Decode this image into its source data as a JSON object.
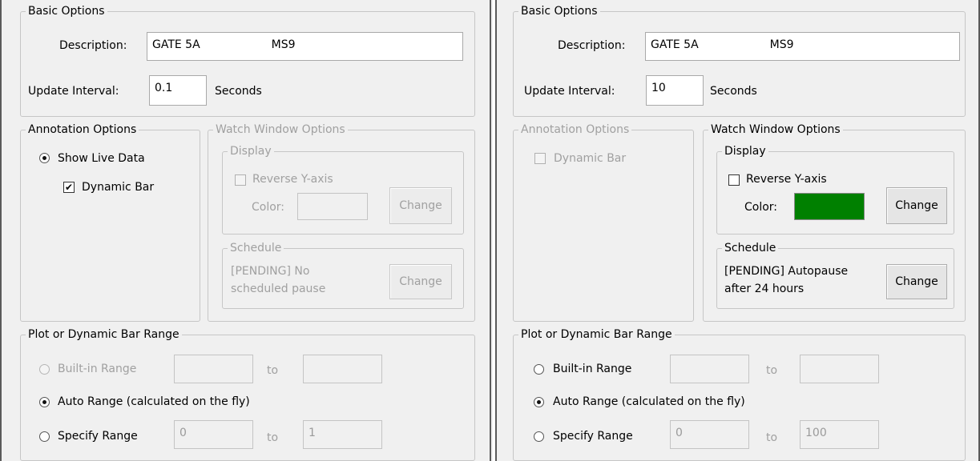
{
  "left": {
    "basic": {
      "legend": "Basic Options",
      "description_label": "Description:",
      "description_value": "GATE 5A                    MS9",
      "interval_label": "Update Interval:",
      "interval_value": "0.1",
      "seconds_label": "Seconds"
    },
    "annotation": {
      "legend": "Annotation Options",
      "show_live_data": "Show Live Data",
      "dynamic_bar": "Dynamic Bar"
    },
    "watch": {
      "legend": "Watch Window Options",
      "display_legend": "Display",
      "reverse_y": "Reverse Y-axis",
      "color_label": "Color:",
      "change_label": "Change",
      "schedule_legend": "Schedule",
      "schedule_text_1": "[PENDING] No",
      "schedule_text_2": "scheduled pause",
      "schedule_change_label": "Change"
    },
    "range": {
      "legend": "Plot or Dynamic Bar Range",
      "builtin": "Built-in Range",
      "auto": "Auto Range (calculated on the fly)",
      "specify": "Specify Range",
      "to1": "to",
      "to2": "to",
      "specify_from": "0",
      "specify_to": "1"
    }
  },
  "right": {
    "basic": {
      "legend": "Basic Options",
      "description_label": "Description:",
      "description_value": "GATE 5A                    MS9",
      "interval_label": "Update Interval:",
      "interval_value": "10",
      "seconds_label": "Seconds"
    },
    "annotation": {
      "legend": "Annotation Options",
      "dynamic_bar": "Dynamic Bar"
    },
    "watch": {
      "legend": "Watch Window Options",
      "display_legend": "Display",
      "reverse_y": "Reverse Y-axis",
      "color_label": "Color:",
      "color_value": "#008000",
      "change_label": "Change",
      "schedule_legend": "Schedule",
      "schedule_text_1": "[PENDING] Autopause",
      "schedule_text_2": "after 24 hours",
      "schedule_change_label": "Change"
    },
    "range": {
      "legend": "Plot or Dynamic Bar Range",
      "builtin": "Built-in Range",
      "auto": "Auto Range (calculated on the fly)",
      "specify": "Specify Range",
      "to1": "to",
      "to2": "to",
      "specify_from": "0",
      "specify_to": "100"
    }
  }
}
